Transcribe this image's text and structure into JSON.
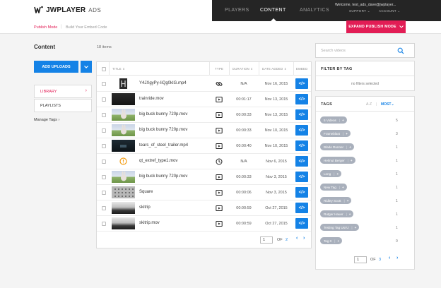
{
  "header": {
    "brand": "JWPLAYER",
    "product": "ADS",
    "nav": [
      "PLAYERS",
      "CONTENT",
      "ANALYTICS"
    ],
    "active_nav": "CONTENT",
    "welcome": "Welcome, test_ads_dave@jwplayer...",
    "support": "SUPPORT",
    "account": "ACCOUNT"
  },
  "subheader": {
    "crumb_active": "Publish Mode",
    "crumb_other": "Build Your Embed Code",
    "expand_label": "EXPAND PUBLISH MODE"
  },
  "sidebar": {
    "title": "Content",
    "add_label": "ADD UPLOADS",
    "items": [
      {
        "label": "LIBRARY",
        "active": true
      },
      {
        "label": "PLAYLISTS",
        "active": false
      }
    ],
    "manage_tags": "Manage Tags"
  },
  "table": {
    "count": "18 items",
    "columns": [
      "TITLE",
      "TYPE",
      "DURATION",
      "DATE ADDED",
      "EMBED"
    ],
    "rows": [
      {
        "title": "Y4JXgyPy-IiQg0kIG.mp4",
        "type": "link",
        "duration": "N/A",
        "date": "Nov 16, 2015",
        "thumb": "logo"
      },
      {
        "title": "trainride.mov",
        "type": "video",
        "duration": "00:01:17",
        "date": "Nov 13, 2015",
        "thumb": "dark"
      },
      {
        "title": "big buck bunny 720p.mov",
        "type": "video",
        "duration": "00:00:33",
        "date": "Nov 13, 2015",
        "thumb": "bunny"
      },
      {
        "title": "big buck bunny 720p.mov",
        "type": "video",
        "duration": "00:00:33",
        "date": "Nov 10, 2015",
        "thumb": "bunny"
      },
      {
        "title": "tears_of_steel_trailer.mp4",
        "type": "video",
        "duration": "00:00:40",
        "date": "Nov 10, 2015",
        "thumb": "steel"
      },
      {
        "title": "qt_extref_type1.mov",
        "type": "clock",
        "duration": "N/A",
        "date": "Nov 6, 2015",
        "thumb": "warning"
      },
      {
        "title": "big buck bunny 720p.mov",
        "type": "video",
        "duration": "00:00:33",
        "date": "Nov 3, 2015",
        "thumb": "bunny"
      },
      {
        "title": "Square",
        "type": "video",
        "duration": "00:00:06",
        "date": "Nov 3, 2015",
        "thumb": "square"
      },
      {
        "title": "skitrip",
        "type": "video",
        "duration": "00:00:59",
        "date": "Oct 27, 2015",
        "thumb": "ski"
      },
      {
        "title": "skitrip.mov",
        "type": "video",
        "duration": "00:00:59",
        "date": "Oct 27, 2015",
        "thumb": "ski"
      }
    ],
    "embed_label": "</>",
    "page_current": "1",
    "page_of": "OF",
    "page_total": "2"
  },
  "search": {
    "placeholder": "Search videos"
  },
  "filter_panel": {
    "title": "FILTER BY TAG",
    "empty_text": "no filters selected"
  },
  "tags_panel": {
    "title": "TAGS",
    "sort_az": "A-Z",
    "sort_most": "MOST",
    "tags": [
      {
        "name": "5 Videos",
        "count": "5"
      },
      {
        "name": "Frameblast",
        "count": "3"
      },
      {
        "name": "Blade Runner",
        "count": "1"
      },
      {
        "name": "Helmut Berger",
        "count": "1"
      },
      {
        "name": "Long",
        "count": "1"
      },
      {
        "name": "New Tag",
        "count": "1"
      },
      {
        "name": "Ridley Scott",
        "count": "1"
      },
      {
        "name": "Rutger Hauer",
        "count": "1"
      },
      {
        "name": "Testing Tag UsVJ",
        "count": "1"
      },
      {
        "name": "Tag 0",
        "count": "0"
      }
    ],
    "page_current": "1",
    "page_of": "OF",
    "page_total": "3"
  },
  "colors": {
    "accent": "#e21d55",
    "primary": "#1482e6",
    "nav_dark": "#252525",
    "tag_bg": "#a9b0bc"
  }
}
